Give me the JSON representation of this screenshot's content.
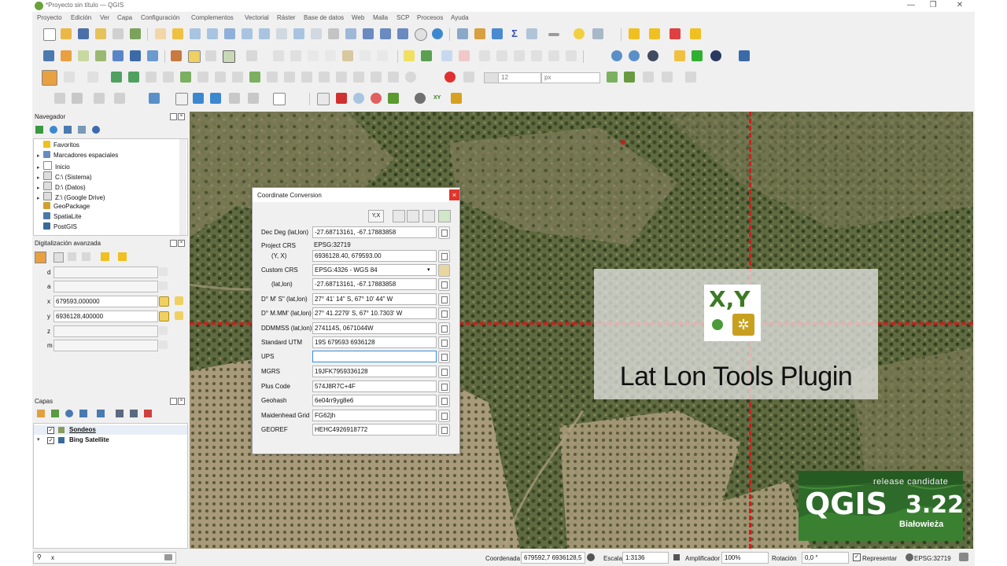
{
  "window": {
    "title": "*Proyecto sin título — QGIS"
  },
  "menu": [
    "Proyecto",
    "Edición",
    "Ver",
    "Capa",
    "Configuración",
    "Complementos",
    "Vectorial",
    "Ráster",
    "Base de datos",
    "Web",
    "Malla",
    "SCP",
    "Procesos",
    "Ayuda"
  ],
  "navigator": {
    "title": "Navegador",
    "items": [
      "Favoritos",
      "Marcadores espaciales",
      "Inicio",
      "C:\\ (Sistema)",
      "D:\\ (Datos)",
      "Z:\\ (Google Drive)",
      "GeoPackage",
      "SpatiaLite",
      "PostGIS"
    ]
  },
  "digitizing": {
    "title": "Digitalización avanzada",
    "fields": [
      {
        "label": "d",
        "value": ""
      },
      {
        "label": "a",
        "value": ""
      },
      {
        "label": "x",
        "value": "679593,000000"
      },
      {
        "label": "y",
        "value": "6936128,400000"
      },
      {
        "label": "z",
        "value": ""
      },
      {
        "label": "m",
        "value": ""
      }
    ]
  },
  "layers": {
    "title": "Capas",
    "items": [
      {
        "name": "Sondeos"
      },
      {
        "name": "Bing Satellite"
      }
    ]
  },
  "toolbar3": {
    "size_value": "12",
    "unit_value": "px"
  },
  "dialog": {
    "title": "Coordinate Conversion",
    "order_button": "Y,X",
    "rows": [
      {
        "label": "Dec Deg (lat,lon)",
        "value": "-27.68713161, -67.17883858"
      },
      {
        "label": "Project CRS",
        "value": "EPSG:32719"
      },
      {
        "label": "(Y, X)",
        "value": "6936128.40, 679593.00"
      },
      {
        "label": "Custom CRS",
        "value": "EPSG:4326 - WGS 84"
      },
      {
        "label": "(lat,lon)",
        "value": "-27.68713161, -67.17883858"
      },
      {
        "label": "D° M' S\" (lat,lon)",
        "value": "27° 41' 14\" S, 67° 10' 44\" W"
      },
      {
        "label": "D° M.MM' (lat,lon)",
        "value": "27° 41.2279' S, 67° 10.7303' W"
      },
      {
        "label": "DDMMSS (lat,lon)",
        "value": "274114S, 0671044W"
      },
      {
        "label": "Standard UTM",
        "value": "19S 679593 6936128"
      },
      {
        "label": "UPS",
        "value": ""
      },
      {
        "label": "MGRS",
        "value": "19JFK7959336128"
      },
      {
        "label": "Plus Code",
        "value": "574J8R7C+4F"
      },
      {
        "label": "Geohash",
        "value": "6e04rr9yg8e6"
      },
      {
        "label": "Maidenhead Grid",
        "value": "FG62jh"
      },
      {
        "label": "GEOREF",
        "value": "HEHC4926918772"
      }
    ]
  },
  "banner": {
    "logo_text": "X,Y",
    "caption": "Lat Lon Tools Plugin"
  },
  "qgis_badge": {
    "tagline": "release candidate",
    "name": "QGIS",
    "version": "3.22",
    "codename": "Białowieża"
  },
  "status": {
    "search_value": "x",
    "coord_label": "Coordenada",
    "coord_value": "679592,7 6936128,5",
    "scale_label": "Escala",
    "scale_value": "1:3136",
    "magnifier_label": "Amplificador",
    "magnifier_value": "100%",
    "rotation_label": "Rotación",
    "rotation_value": "0,0 °",
    "render_label": "Representar",
    "crs_value": "EPSG:32719"
  },
  "colors": {
    "accent_red": "#e0362e",
    "crosshair": "#d41c1c",
    "qgis_green": "#2e6b2a"
  }
}
